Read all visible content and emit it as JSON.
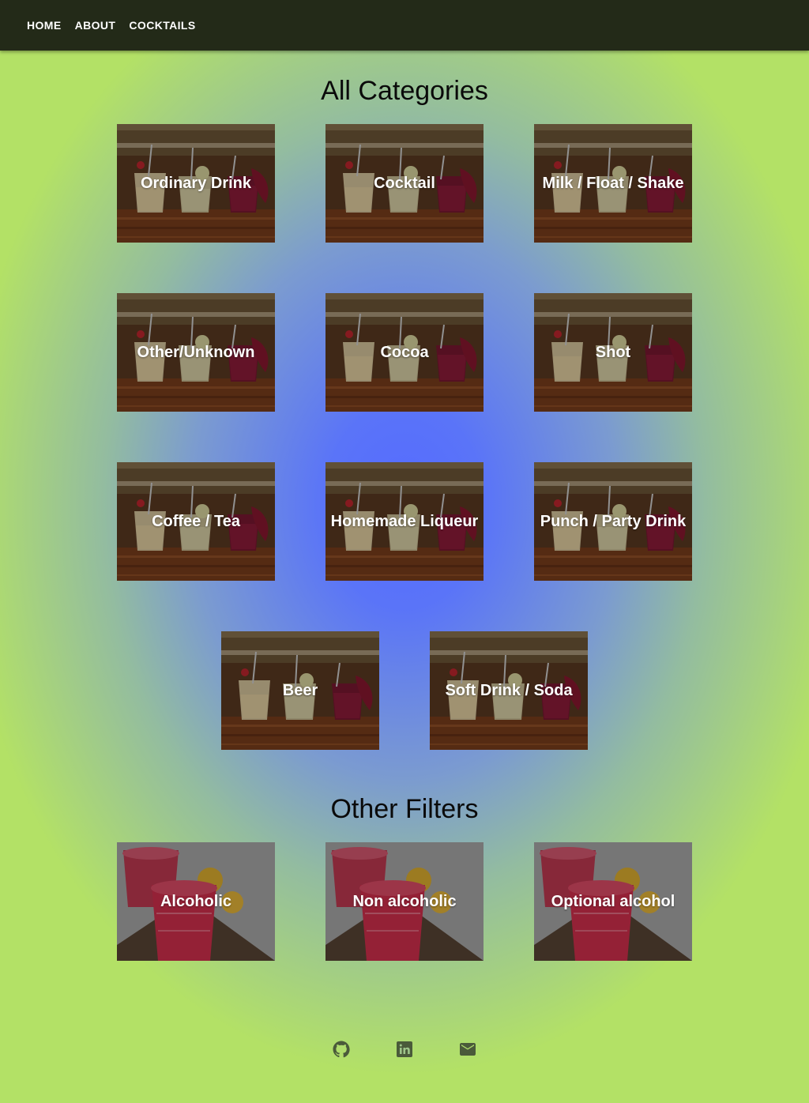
{
  "nav": {
    "items": [
      {
        "label": "HOME"
      },
      {
        "label": "ABOUT"
      },
      {
        "label": "COCKTAILS"
      }
    ]
  },
  "categories": {
    "title": "All Categories",
    "items": [
      {
        "label": "Ordinary Drink"
      },
      {
        "label": "Cocktail"
      },
      {
        "label": "Milk / Float / Shake"
      },
      {
        "label": "Other/Unknown"
      },
      {
        "label": "Cocoa"
      },
      {
        "label": "Shot"
      },
      {
        "label": "Coffee / Tea"
      },
      {
        "label": "Homemade Liqueur"
      },
      {
        "label": "Punch / Party Drink"
      },
      {
        "label": "Beer"
      },
      {
        "label": "Soft Drink / Soda"
      }
    ]
  },
  "filters": {
    "title": "Other Filters",
    "items": [
      {
        "label": "Alcoholic"
      },
      {
        "label": "Non alcoholic"
      },
      {
        "label": "Optional alcohol"
      }
    ]
  },
  "footer": {
    "icons": [
      "github-icon",
      "linkedin-icon",
      "email-icon"
    ],
    "icon_color": "#4a5a3a"
  },
  "colors": {
    "navbar": "#232a18",
    "gradient_center": "#556bff",
    "gradient_edge": "#b3e166"
  }
}
